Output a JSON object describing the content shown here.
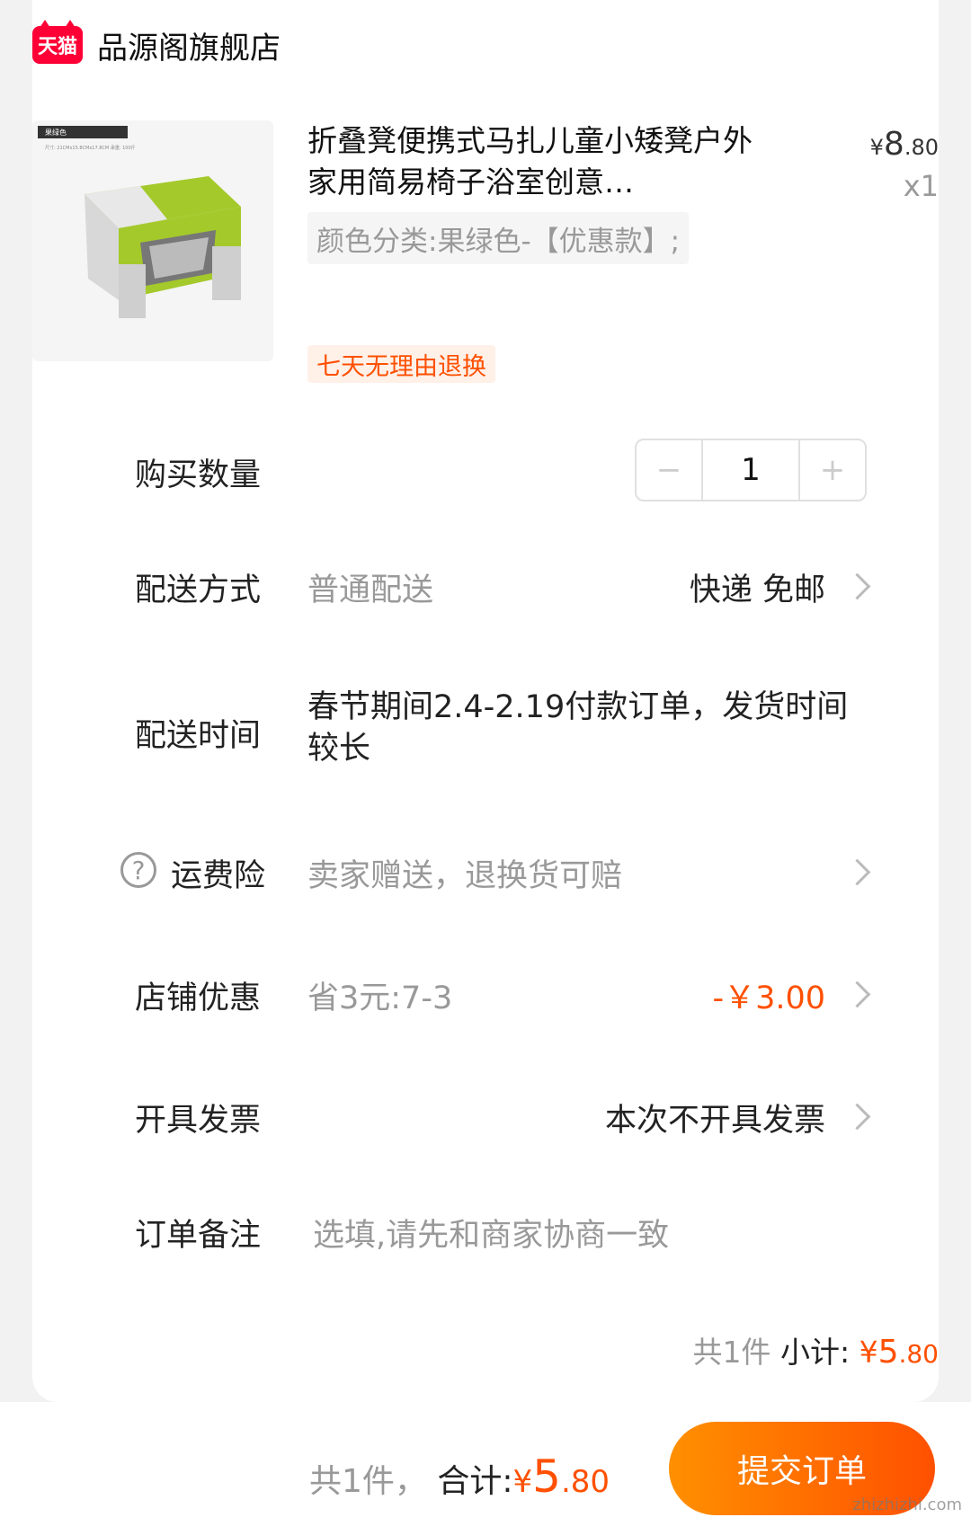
{
  "shop": {
    "logo_text": "天猫",
    "name": "品源阁旗舰店"
  },
  "product": {
    "image_label": "果绿色",
    "image_caption": "尺寸: 21CMx15.8CMx17.8CM 承重: 100斤",
    "title": "折叠凳便携式马扎儿童小矮凳户外家用简易椅子浴室创意…",
    "price_symbol": "¥",
    "price_int": "8",
    "price_dec": ".80",
    "quantity_text": "x1",
    "sku": "颜色分类:果绿色-【优惠款】;",
    "tag": "七天无理由退换"
  },
  "quantity": {
    "label": "购买数量",
    "minus": "−",
    "value": "1",
    "plus": "+"
  },
  "delivery": {
    "label": "配送方式",
    "value": "普通配送",
    "right": "快递 免邮"
  },
  "delivery_time": {
    "label": "配送时间",
    "value": "春节期间2.4-2.19付款订单，发货时间较长"
  },
  "insurance": {
    "icon": "?",
    "label": "运费险",
    "value": "卖家赠送，退换货可赔"
  },
  "discount": {
    "label": "店铺优惠",
    "value": "省3元:7-3",
    "right": "-￥3.00"
  },
  "invoice": {
    "label": "开具发票",
    "right": "本次不开具发票"
  },
  "note": {
    "label": "订单备注",
    "placeholder": "选填,请先和商家协商一致"
  },
  "subtotal": {
    "count": "共1件",
    "label": "小计:",
    "symbol": "¥",
    "int": "5",
    "dec": ".80"
  },
  "footer": {
    "count": "共1件，",
    "label": "合计:",
    "symbol": "¥",
    "int": "5",
    "dec": ".80",
    "submit": "提交订单",
    "watermark": "zhizhizhi.com"
  },
  "colors": {
    "accent": "#ff5000",
    "tmall": "#ff0036",
    "product_green": "#a4c92b"
  }
}
